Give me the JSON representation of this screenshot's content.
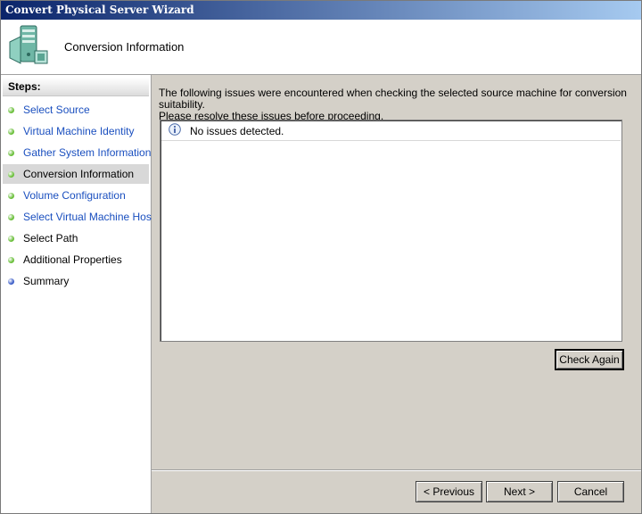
{
  "window": {
    "title": "Convert Physical Server Wizard"
  },
  "header": {
    "title": "Conversion Information",
    "icon": "server-wizard-icon"
  },
  "sidebar": {
    "heading": "Steps:",
    "steps": [
      {
        "label": "Select Source",
        "status": "done",
        "dot_color": "#6abf3a",
        "link": true
      },
      {
        "label": "Virtual Machine Identity",
        "status": "done",
        "dot_color": "#6abf3a",
        "link": true
      },
      {
        "label": "Gather System Information",
        "status": "done",
        "dot_color": "#6abf3a",
        "link": true
      },
      {
        "label": "Conversion Information",
        "status": "current",
        "dot_color": "#6abf3a",
        "link": false
      },
      {
        "label": "Volume Configuration",
        "status": "done",
        "dot_color": "#6abf3a",
        "link": true
      },
      {
        "label": "Select Virtual Machine Host",
        "status": "done",
        "dot_color": "#6abf3a",
        "link": true
      },
      {
        "label": "Select Path",
        "status": "pending",
        "dot_color": "#6abf3a",
        "link": false
      },
      {
        "label": "Additional Properties",
        "status": "pending",
        "dot_color": "#6abf3a",
        "link": false
      },
      {
        "label": "Summary",
        "status": "pending",
        "dot_color": "#3c5ec8",
        "link": false
      }
    ]
  },
  "main": {
    "instructions_line1": "The following issues were encountered when checking the selected source machine for conversion suitability.",
    "instructions_line2": "Please resolve these issues before proceeding.",
    "issues": [
      {
        "icon": "info-icon",
        "text": "No issues detected."
      }
    ],
    "check_again_label": "Check Again"
  },
  "footer": {
    "previous_prefix": "< ",
    "previous_label": "Previous",
    "next_label": "Next",
    "next_suffix": " >",
    "cancel_label": "Cancel"
  },
  "colors": {
    "link": "#1a4fbf",
    "title_start": "#0a246a",
    "title_end": "#a6caf0"
  }
}
